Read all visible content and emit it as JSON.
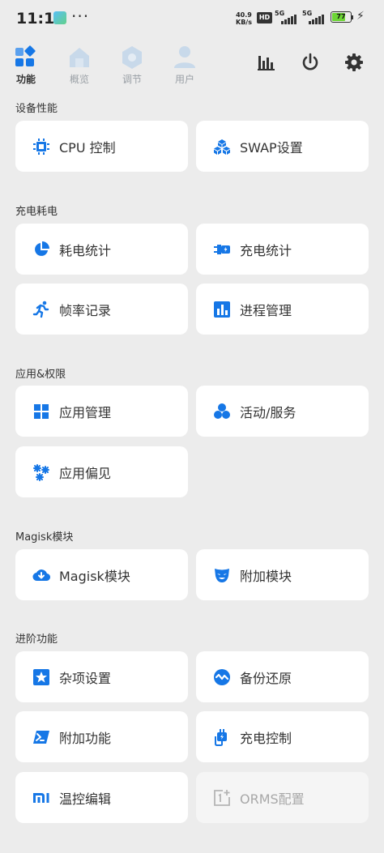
{
  "status_bar": {
    "time": "11:16",
    "more": "···",
    "net_speed_value": "40.9",
    "net_speed_unit": "KB/s",
    "hd_label": "HD",
    "sim1_label": "5G",
    "sim2_label": "5G",
    "battery_level": "77",
    "battery_fraction": 0.77
  },
  "tabs": [
    {
      "label": "功能",
      "icon": "grid-icon",
      "active": true
    },
    {
      "label": "概览",
      "icon": "home-icon",
      "active": false
    },
    {
      "label": "调节",
      "icon": "hexagon-icon",
      "active": false
    },
    {
      "label": "用户",
      "icon": "user-icon",
      "active": false
    }
  ],
  "top_actions": [
    {
      "icon": "bar-chart-icon"
    },
    {
      "icon": "power-icon"
    },
    {
      "icon": "gear-icon"
    }
  ],
  "accent_color": "#1677e6",
  "sections": [
    {
      "title": "设备性能",
      "items": [
        {
          "label": "CPU 控制",
          "icon": "cpu-icon"
        },
        {
          "label": "SWAP设置",
          "icon": "cubes-icon"
        }
      ]
    },
    {
      "title": "充电耗电",
      "items": [
        {
          "label": "耗电统计",
          "icon": "pie-chart-icon"
        },
        {
          "label": "充电统计",
          "icon": "charger-plug-icon"
        },
        {
          "label": "帧率记录",
          "icon": "running-icon"
        },
        {
          "label": "进程管理",
          "icon": "bar-chart-box-icon"
        }
      ]
    },
    {
      "title": "应用&权限",
      "items": [
        {
          "label": "应用管理",
          "icon": "app-grid-icon"
        },
        {
          "label": "活动/服务",
          "icon": "bubbles-icon"
        },
        {
          "label": "应用偏见",
          "icon": "snowflakes-icon"
        }
      ]
    },
    {
      "title": "Magisk模块",
      "items": [
        {
          "label": "Magisk模块",
          "icon": "cloud-download-icon"
        },
        {
          "label": "附加模块",
          "icon": "mask-icon"
        }
      ]
    },
    {
      "title": "进阶功能",
      "items": [
        {
          "label": "杂项设置",
          "icon": "star-box-icon"
        },
        {
          "label": "备份还原",
          "icon": "wave-circle-icon"
        },
        {
          "label": "附加功能",
          "icon": "terminal-icon"
        },
        {
          "label": "充电控制",
          "icon": "charging-cable-icon"
        },
        {
          "label": "温控编辑",
          "icon": "mi-logo-icon"
        },
        {
          "label": "ORMS配置",
          "icon": "oneplus-logo-icon",
          "disabled": true
        }
      ]
    }
  ]
}
